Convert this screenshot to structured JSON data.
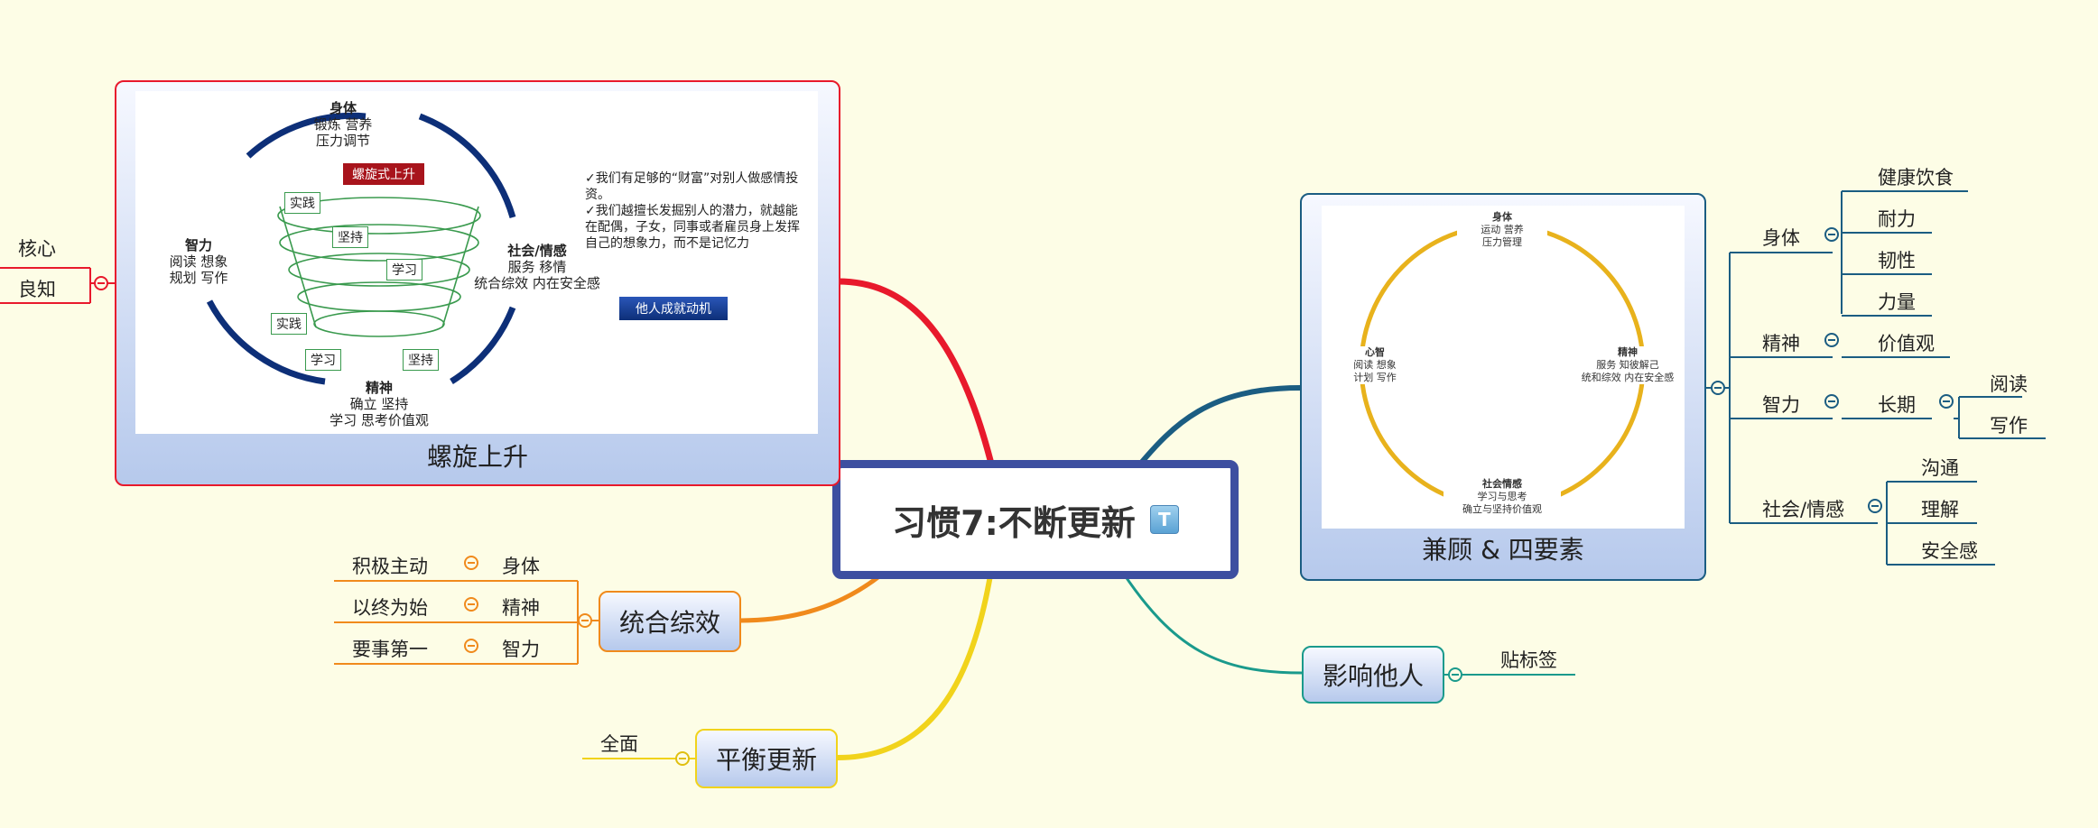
{
  "central": {
    "title": "习惯7:不断更新",
    "badge": "T"
  },
  "spiral": {
    "caption": "螺旋上升",
    "labels": {
      "top_title": "身体",
      "top_1": "锻炼 营养",
      "top_2": "压力调节",
      "left_title": "智力",
      "left_1": "阅读 想象",
      "left_2": "规划 写作",
      "right_title": "社会/情感",
      "right_1": "服务 移情",
      "right_2": "统合综效 内在安全感",
      "bottom_title": "精神",
      "bottom_1": "确立 坚持",
      "bottom_2": "学习 思考价值观",
      "red_box": "螺旋式上升",
      "b1": "实践",
      "b2": "坚持",
      "b3": "学习",
      "b4": "实践",
      "b5": "学习",
      "b6": "坚持"
    },
    "notes": [
      "✓我们有足够的“财富”对别人做感情投资。",
      "✓我们越擅长发掘别人的潜力，就越能在配偶，子女，同事或者雇员身上发挥自己的想象力，而不是记忆力"
    ],
    "blue_button": "他人成就动机"
  },
  "left_branch": {
    "title": "良知",
    "child": "核心"
  },
  "synergy": {
    "title": "统合综效",
    "rows": [
      {
        "habit": "积极主动",
        "aspect": "身体"
      },
      {
        "habit": "以终为始",
        "aspect": "精神"
      },
      {
        "habit": "要事第一",
        "aspect": "智力"
      }
    ]
  },
  "balance": {
    "title": "平衡更新",
    "child": "全面"
  },
  "four": {
    "caption": "兼顾 & 四要素",
    "labels": {
      "top_title": "身体",
      "top_1": "运动 营养",
      "top_2": "压力管理",
      "left_title": "心智",
      "left_1": "阅读 想象",
      "left_2": "计划 写作",
      "right_title": "精神",
      "right_1": "服务 知彼解己",
      "right_2": "统和综效 内在安全感",
      "bottom_title": "社会情感",
      "bottom_1": "学习与思考",
      "bottom_2": "确立与坚持价值观"
    },
    "tree": {
      "body": "身体",
      "body_children": [
        "健康饮食",
        "耐力",
        "韧性",
        "力量"
      ],
      "spirit": "精神",
      "spirit_child": "价值观",
      "intellect": "智力",
      "intellect_child": "长期",
      "long_children": [
        "阅读",
        "写作"
      ],
      "social": "社会/情感",
      "social_children": [
        "沟通",
        "理解",
        "安全感"
      ]
    }
  },
  "influence": {
    "title": "影响他人",
    "child": "贴标签"
  },
  "colors": {
    "red": "#e8192c",
    "orange": "#f08a1c",
    "yellow": "#f1d31b",
    "teal": "#1a9a8c",
    "blue": "#1b5d82",
    "navy": "#3d4fa0",
    "gold": "#e8b21c"
  }
}
